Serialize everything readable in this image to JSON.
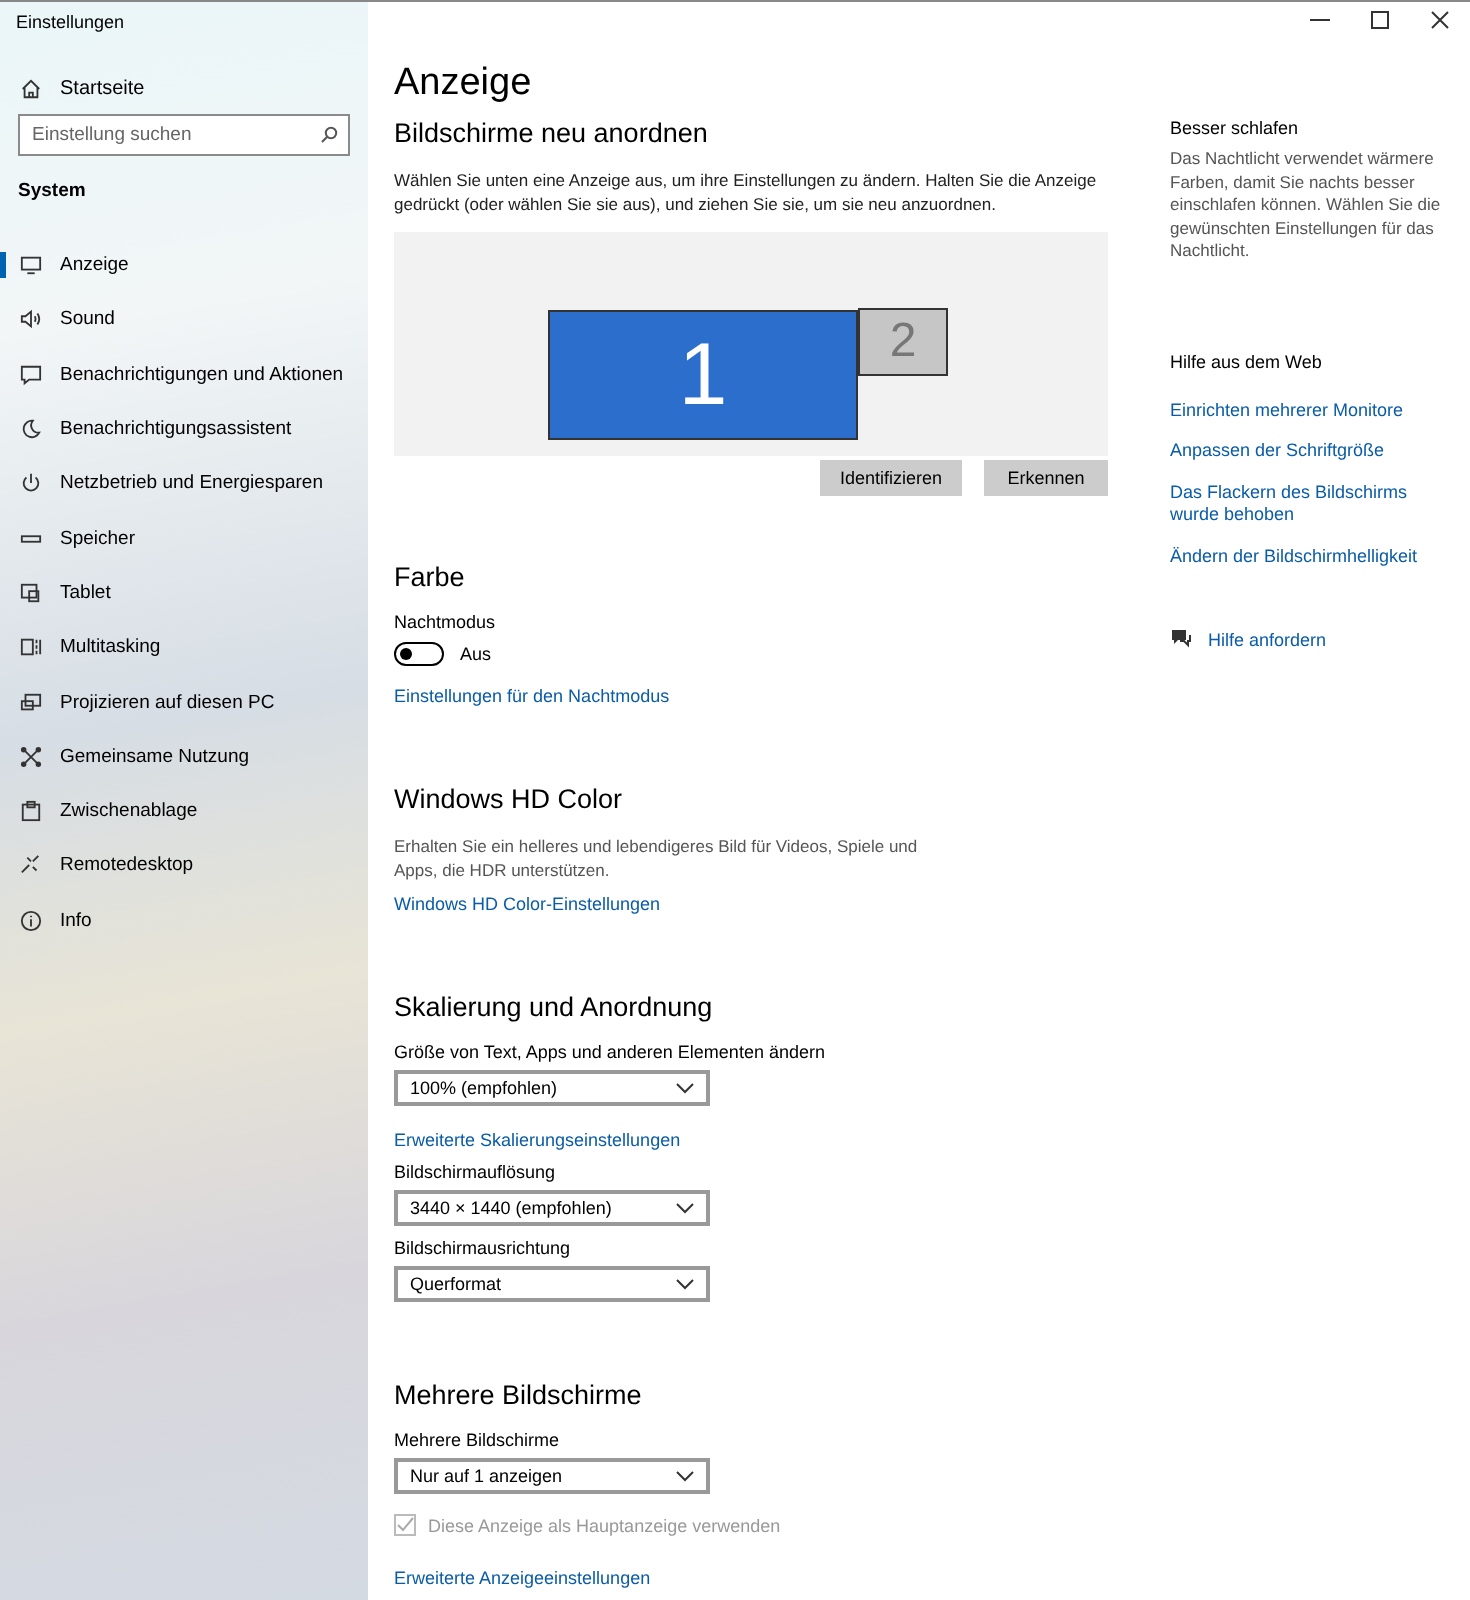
{
  "window": {
    "title": "Einstellungen"
  },
  "sidebar": {
    "home": "Startseite",
    "search": {
      "placeholder": "Einstellung suchen"
    },
    "section": "System",
    "items": [
      {
        "label": "Anzeige",
        "selected": true
      },
      {
        "label": "Sound",
        "selected": false
      },
      {
        "label": "Benachrichtigungen und Aktionen",
        "selected": false
      },
      {
        "label": "Benachrichtigungsassistent",
        "selected": false
      },
      {
        "label": "Netzbetrieb und Energiesparen",
        "selected": false
      },
      {
        "label": "Speicher",
        "selected": false
      },
      {
        "label": "Tablet",
        "selected": false
      },
      {
        "label": "Multitasking",
        "selected": false
      },
      {
        "label": "Projizieren auf diesen PC",
        "selected": false
      },
      {
        "label": "Gemeinsame Nutzung",
        "selected": false
      },
      {
        "label": "Zwischenablage",
        "selected": false
      },
      {
        "label": "Remotedesktop",
        "selected": false
      },
      {
        "label": "Info",
        "selected": false
      }
    ]
  },
  "main": {
    "title": "Anzeige",
    "arrange": {
      "heading": "Bildschirme neu anordnen",
      "description": "Wählen Sie unten eine Anzeige aus, um ihre Einstellungen zu ändern. Halten Sie die Anzeige gedrückt (oder wählen Sie sie aus), und ziehen Sie sie, um sie neu anzuordnen.",
      "monitors": [
        {
          "label": "1",
          "selected": true
        },
        {
          "label": "2",
          "selected": false
        }
      ],
      "buttons": [
        "Identifizieren",
        "Erkennen"
      ]
    },
    "sections": [
      {
        "heading": "Farbe",
        "items": [
          {
            "kind": "label",
            "text": "Nachtmodus"
          },
          {
            "kind": "toggle",
            "on": false,
            "state": "Aus"
          },
          {
            "kind": "link",
            "text": "Einstellungen für den Nachtmodus"
          }
        ]
      },
      {
        "heading": "Windows HD Color",
        "items": [
          {
            "kind": "description",
            "text": "Erhalten Sie ein helleres und lebendigeres Bild für Videos, Spiele und Apps, die HDR unterstützen."
          },
          {
            "kind": "link",
            "text": "Windows HD Color-Einstellungen"
          }
        ]
      },
      {
        "heading": "Skalierung und Anordnung",
        "items": [
          {
            "kind": "label",
            "text": "Größe von Text, Apps und anderen Elementen ändern"
          },
          {
            "kind": "dropdown",
            "value": "100% (empfohlen)"
          },
          {
            "kind": "link",
            "text": "Erweiterte Skalierungseinstellungen"
          },
          {
            "kind": "label",
            "text": "Bildschirmauflösung"
          },
          {
            "kind": "dropdown",
            "value": "3440 × 1440 (empfohlen)"
          },
          {
            "kind": "label",
            "text": "Bildschirmausrichtung"
          },
          {
            "kind": "dropdown",
            "value": "Querformat"
          }
        ]
      },
      {
        "heading": "Mehrere Bildschirme",
        "items": [
          {
            "kind": "label",
            "text": "Mehrere Bildschirme"
          },
          {
            "kind": "dropdown",
            "value": "Nur auf 1 anzeigen"
          },
          {
            "kind": "checkbox",
            "checked": true,
            "disabled": true,
            "text": "Diese Anzeige als Hauptanzeige verwenden"
          },
          {
            "kind": "link",
            "text": "Erweiterte Anzeigeeinstellungen"
          }
        ]
      }
    ]
  },
  "aside": {
    "tip": {
      "heading": "Besser schlafen",
      "text": "Das Nachtlicht verwendet wärmere Farben, damit Sie nachts besser einschlafen können. Wählen Sie die gewünschten Einstellungen für das Nachtlicht."
    },
    "help": {
      "heading": "Hilfe aus dem Web",
      "links": [
        "Einrichten mehrerer Monitore",
        "Anpassen der Schriftgröße",
        "Das Flackern des Bildschirms wurde behoben",
        "Ändern der Bildschirmhelligkeit"
      ]
    },
    "support_link": "Hilfe anfordern"
  }
}
